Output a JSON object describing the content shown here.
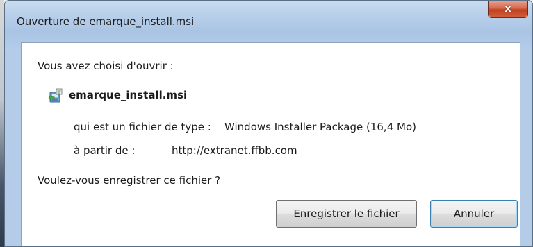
{
  "window": {
    "title": "Ouverture de emarque_install.msi"
  },
  "dialog": {
    "prompt_open": "Vous avez choisi d'ouvrir :",
    "file_name": "emarque_install.msi",
    "file_icon": "msi-installer-icon",
    "type_label": "qui est un fichier de type :",
    "type_value": "Windows Installer Package (16,4 Mo)",
    "from_label": "à partir de :",
    "from_value": "http://extranet.ffbb.com",
    "question": "Voulez-vous enregistrer ce fichier ?"
  },
  "buttons": {
    "close_glyph": "x",
    "save_label": "Enregistrer le fichier",
    "cancel_label": "Annuler"
  },
  "colors": {
    "close_button": "#c8492a",
    "titlebar": "#b9d0ea",
    "focus_border": "#3c7fb1"
  }
}
